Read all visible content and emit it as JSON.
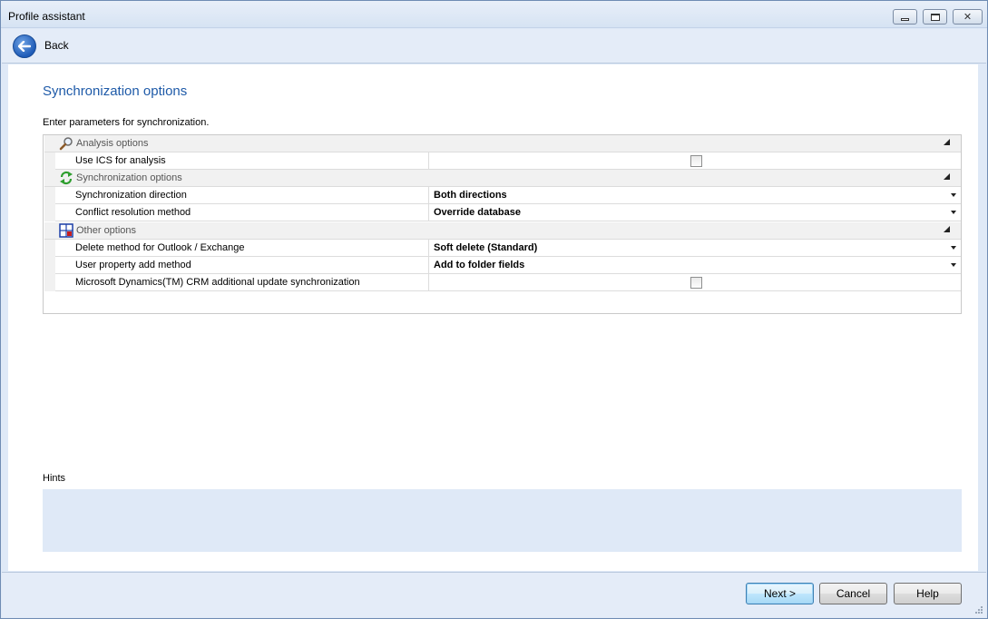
{
  "window": {
    "title": "Profile assistant"
  },
  "nav": {
    "back_label": "Back"
  },
  "page": {
    "title": "Synchronization options",
    "description": "Enter parameters for synchronization."
  },
  "grid": {
    "categories": [
      {
        "label": "Analysis options",
        "icon": "magnifier-icon"
      },
      {
        "label": "Synchronization options",
        "icon": "sync-arrows-icon"
      },
      {
        "label": "Other options",
        "icon": "grid-options-icon"
      }
    ],
    "properties": [
      {
        "name": "Use ICS for analysis",
        "value": "",
        "type": "checkbox",
        "checked": false
      },
      {
        "name": "Synchronization direction",
        "value": "Both directions",
        "type": "dropdown"
      },
      {
        "name": "Conflict resolution method",
        "value": "Override database",
        "type": "dropdown"
      },
      {
        "name": "Delete method for Outlook / Exchange",
        "value": "Soft delete (Standard)",
        "type": "dropdown"
      },
      {
        "name": "User property add method",
        "value": "Add to folder fields",
        "type": "dropdown"
      },
      {
        "name": "Microsoft Dynamics(TM) CRM additional update synchronization",
        "value": "",
        "type": "checkbox",
        "checked": false
      }
    ]
  },
  "hints": {
    "label": "Hints",
    "text": ""
  },
  "buttons": {
    "next": "Next >",
    "cancel": "Cancel",
    "help": "Help"
  },
  "colors": {
    "title_blue": "#1e5aa8",
    "panel_blue": "#dfe9f7"
  }
}
